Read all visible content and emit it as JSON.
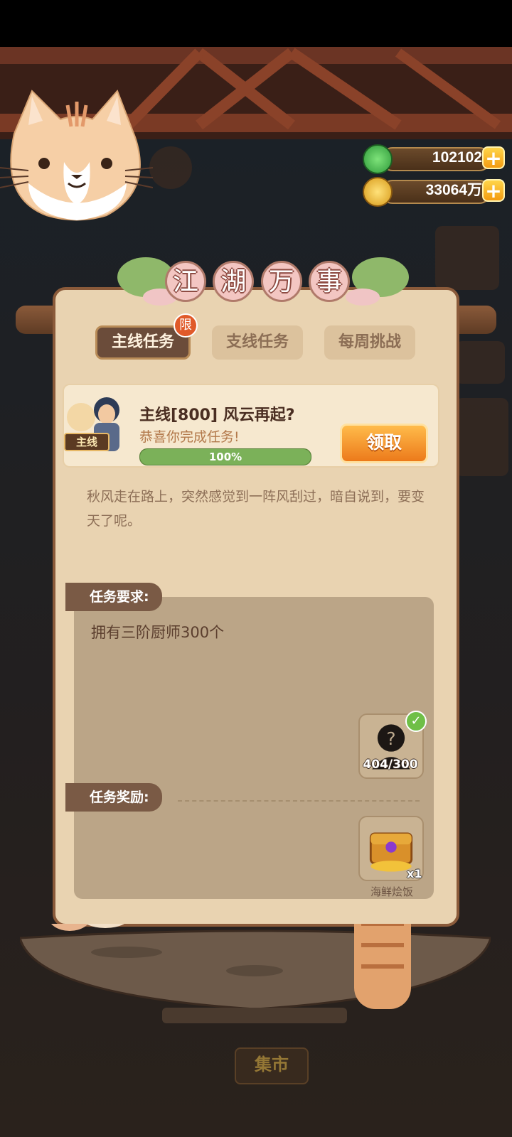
{
  "currency": {
    "jade": "102102",
    "coins": "33064万"
  },
  "title": {
    "chars": [
      "江",
      "湖",
      "万",
      "事"
    ]
  },
  "tabs": [
    {
      "label": "主线任务",
      "badge": "限"
    },
    {
      "label": "支线任务"
    },
    {
      "label": "每周挑战"
    }
  ],
  "quest": {
    "tag": "主线",
    "title": "主线[800] 风云再起?",
    "subtitle": "恭喜你完成任务!",
    "progress_pct": 100,
    "progress_label": "100%",
    "claim_label": "领取",
    "description": "秋风走在路上，突然感觉到一阵风刮过，暗自说到，要变天了呢。"
  },
  "requirement": {
    "label": "任务要求:",
    "text": "拥有三阶厨师300个",
    "count": "404/300"
  },
  "reward": {
    "label": "任务奖励:",
    "qty": "x1",
    "name": "海鲜烩饭"
  },
  "bottom": {
    "market": "集市"
  },
  "colors": {
    "panel": "#e9d3b1",
    "accent_orange": "#ec7a1b",
    "progress_green": "#7bb159"
  }
}
